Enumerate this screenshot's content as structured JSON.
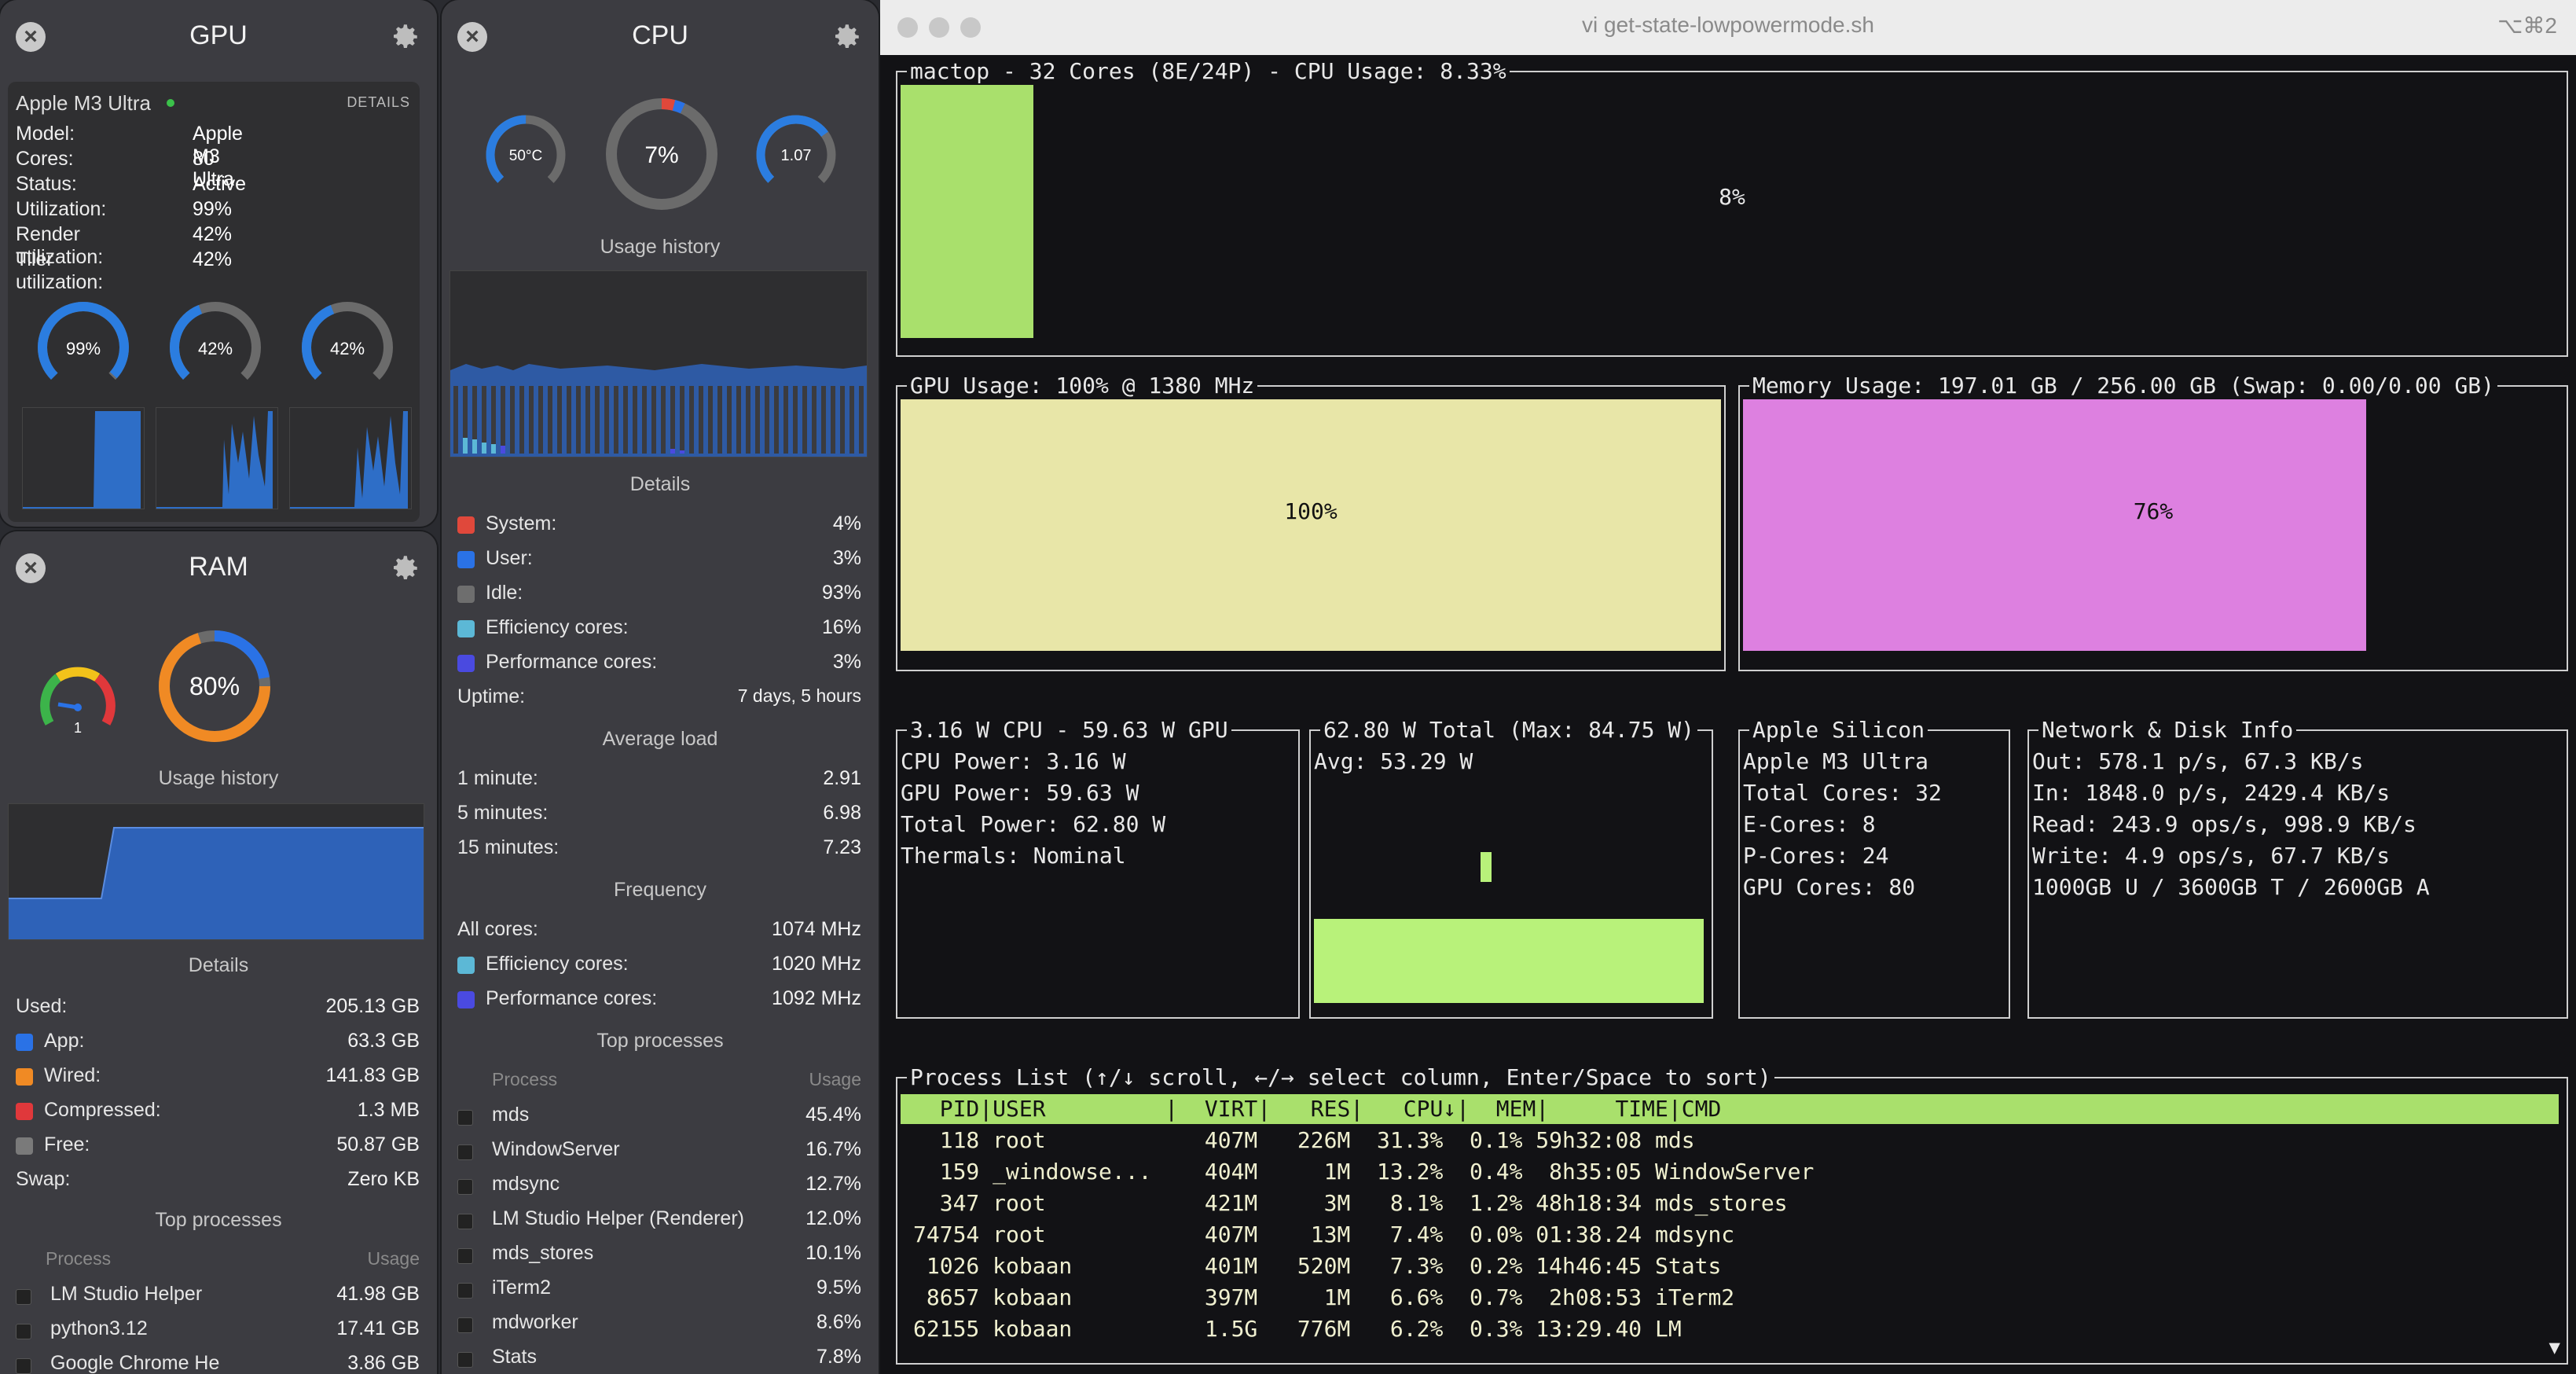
{
  "gpu_widget": {
    "title": "GPU",
    "device_name": "Apple M3 Ultra",
    "details_label": "DETAILS",
    "info": [
      {
        "key": "Model:",
        "value": "Apple M3 Ultra"
      },
      {
        "key": "Cores:",
        "value": "80"
      },
      {
        "key": "Status:",
        "value": "Active"
      },
      {
        "key": "Utilization:",
        "value": "99%"
      },
      {
        "key": "Render utilization:",
        "value": "42%"
      },
      {
        "key": "Tiler utilization:",
        "value": "42%"
      }
    ],
    "gauges": [
      {
        "label": "99%",
        "fraction": 0.99,
        "color": "#2b7de0"
      },
      {
        "label": "42%",
        "fraction": 0.42,
        "color": "#2b7de0"
      },
      {
        "label": "42%",
        "fraction": 0.42,
        "color": "#2b7de0"
      }
    ]
  },
  "ram_widget": {
    "title": "RAM",
    "pressure_value": "1",
    "usage_label": "80%",
    "usage_fraction": 0.8,
    "usage_history_title": "Usage history",
    "details_title": "Details",
    "details": [
      {
        "label": "Used:",
        "value": "205.13 GB",
        "color": ""
      },
      {
        "label": "App:",
        "value": "63.3 GB",
        "color": "#2a72e6"
      },
      {
        "label": "Wired:",
        "value": "141.83 GB",
        "color": "#f08a24"
      },
      {
        "label": "Compressed:",
        "value": "1.3 MB",
        "color": "#e0383b"
      },
      {
        "label": "Free:",
        "value": "50.87 GB",
        "color": "#7a7a7a"
      },
      {
        "label": "Swap:",
        "value": "Zero KB",
        "color": ""
      }
    ],
    "top_processes_title": "Top processes",
    "process_header": "Process",
    "usage_header": "Usage",
    "processes": [
      {
        "name": "LM Studio Helper",
        "value": "41.98 GB"
      },
      {
        "name": "python3.12",
        "value": "17.41 GB"
      },
      {
        "name": "Google Chrome He",
        "value": "3.86 GB"
      }
    ]
  },
  "cpu_widget": {
    "title": "CPU",
    "temp_label": "50°C",
    "temp_fraction": 0.5,
    "usage_label": "7%",
    "usage_fraction": 0.07,
    "load_label": "1.07",
    "load_fraction": 0.7,
    "usage_history_title": "Usage history",
    "details_title": "Details",
    "details": [
      {
        "label": "System:",
        "value": "4%",
        "color": "#e0483b"
      },
      {
        "label": "User:",
        "value": "3%",
        "color": "#2a72e6"
      },
      {
        "label": "Idle:",
        "value": "93%",
        "color": "#6e6e6e"
      },
      {
        "label": "Efficiency cores:",
        "value": "16%",
        "color": "#5cb8d6"
      },
      {
        "label": "Performance cores:",
        "value": "3%",
        "color": "#4a4ae0"
      }
    ],
    "uptime_label": "Uptime:",
    "uptime_value": "7 days, 5 hours",
    "avg_load_title": "Average load",
    "avg_load": [
      {
        "label": "1 minute:",
        "value": "2.91"
      },
      {
        "label": "5 minutes:",
        "value": "6.98"
      },
      {
        "label": "15 minutes:",
        "value": "7.23"
      }
    ],
    "frequency_title": "Frequency",
    "frequency": [
      {
        "label": "All cores:",
        "value": "1074 MHz",
        "color": ""
      },
      {
        "label": "Efficiency cores:",
        "value": "1020 MHz",
        "color": "#5cb8d6"
      },
      {
        "label": "Performance cores:",
        "value": "1092 MHz",
        "color": "#4a4ae0"
      }
    ],
    "top_processes_title": "Top processes",
    "process_header": "Process",
    "usage_header": "Usage",
    "processes": [
      {
        "name": "mds",
        "value": "45.4%"
      },
      {
        "name": "WindowServer",
        "value": "16.7%"
      },
      {
        "name": "mdsync",
        "value": "12.7%"
      },
      {
        "name": "LM Studio Helper (Renderer)",
        "value": "12.0%"
      },
      {
        "name": "mds_stores",
        "value": "10.1%"
      },
      {
        "name": "iTerm2",
        "value": "9.5%"
      },
      {
        "name": "mdworker",
        "value": "8.6%"
      },
      {
        "name": "Stats",
        "value": "7.8%"
      }
    ]
  },
  "terminal": {
    "window_title": "vi get-state-lowpowermode.sh",
    "shortcut": "⌥⌘2",
    "cpu_box_title": "mactop - 32 Cores (8E/24P) - CPU Usage: 8.33%",
    "cpu_percent_label": "8%",
    "cpu_fraction": 0.08,
    "gpu_box_title": "GPU Usage: 100% @ 1380 MHz",
    "gpu_percent_label": "100%",
    "gpu_fraction": 1.0,
    "mem_box_title": "Memory Usage: 197.01 GB / 256.00 GB (Swap: 0.00/0.00 GB)",
    "mem_percent_label": "76%",
    "mem_fraction": 0.76,
    "power_box_title": "3.16 W CPU - 59.63 W GPU",
    "power_lines": [
      "CPU Power: 3.16 W",
      "GPU Power: 59.63 W",
      "Total Power: 62.80 W",
      "Thermals: Nominal"
    ],
    "total_box_title": "62.80 W Total (Max: 84.75 W)",
    "total_avg": "Avg: 53.29 W",
    "total_avg_watts": 53.29,
    "total_max_watts": 84.75,
    "silicon_box_title": "Apple Silicon",
    "silicon_lines": [
      "Apple M3 Ultra",
      "Total Cores: 32",
      "E-Cores: 8",
      "P-Cores: 24",
      "GPU Cores: 80"
    ],
    "net_box_title": "Network & Disk Info",
    "net_lines": [
      "Out: 578.1 p/s, 67.3 KB/s",
      "In: 1848.0 p/s, 2429.4 KB/s",
      "Read: 243.9 ops/s, 998.9 KB/s",
      "Write: 4.9 ops/s, 67.7 KB/s",
      "1000GB U / 3600GB T / 2600GB A"
    ],
    "proc_box_title": "Process List (↑/↓ scroll, ←/→ select column, Enter/Space to sort)",
    "proc_header": "  PID|USER         |  VIRT|   RES|   CPU↓|  MEM|     TIME|CMD",
    "proc_rows": [
      "  118 root            407M   226M  31.3%  0.1% 59h32:08 mds",
      "  159 _windowse...    404M     1M  13.2%  0.4%  8h35:05 WindowServer",
      "  347 root            421M     3M   8.1%  1.2% 48h18:34 mds_stores",
      "74754 root            407M    13M   7.4%  0.0% 01:38.24 mdsync",
      " 1026 kobaan          401M   520M   7.3%  0.2% 14h46:45 Stats",
      " 8657 kobaan          397M     1M   6.6%  0.7%  2h08:53 iTerm2",
      "62155 kobaan          1.5G   776M   6.2%  0.3% 13:29.40 LM"
    ]
  }
}
